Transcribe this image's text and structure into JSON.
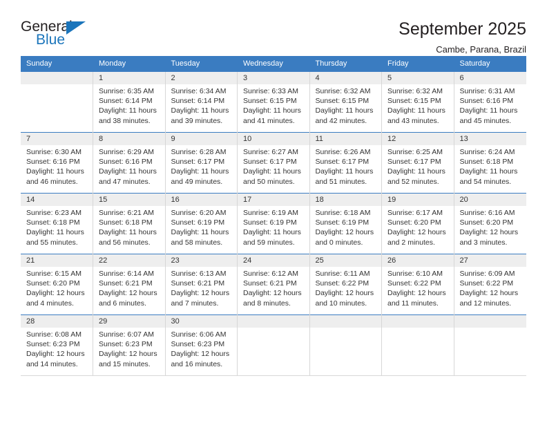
{
  "brand": {
    "name_top": "General",
    "name_bottom": "Blue",
    "accent_color": "#1b75bb"
  },
  "header": {
    "title": "September 2025",
    "subtitle": "Cambe, Parana, Brazil"
  },
  "theme": {
    "header_row_bg": "#3a7cc1",
    "daynum_bg": "#eeeeee",
    "text_color": "#333333",
    "cell_border": "#d7d7d7"
  },
  "weekdays": [
    "Sunday",
    "Monday",
    "Tuesday",
    "Wednesday",
    "Thursday",
    "Friday",
    "Saturday"
  ],
  "labels": {
    "sunrise": "Sunrise:",
    "sunset": "Sunset:",
    "daylight": "Daylight:"
  },
  "weeks": [
    [
      {
        "day": ""
      },
      {
        "day": "1",
        "sunrise": "Sunrise: 6:35 AM",
        "sunset": "Sunset: 6:14 PM",
        "daylight_1": "Daylight: 11 hours",
        "daylight_2": "and 38 minutes."
      },
      {
        "day": "2",
        "sunrise": "Sunrise: 6:34 AM",
        "sunset": "Sunset: 6:14 PM",
        "daylight_1": "Daylight: 11 hours",
        "daylight_2": "and 39 minutes."
      },
      {
        "day": "3",
        "sunrise": "Sunrise: 6:33 AM",
        "sunset": "Sunset: 6:15 PM",
        "daylight_1": "Daylight: 11 hours",
        "daylight_2": "and 41 minutes."
      },
      {
        "day": "4",
        "sunrise": "Sunrise: 6:32 AM",
        "sunset": "Sunset: 6:15 PM",
        "daylight_1": "Daylight: 11 hours",
        "daylight_2": "and 42 minutes."
      },
      {
        "day": "5",
        "sunrise": "Sunrise: 6:32 AM",
        "sunset": "Sunset: 6:15 PM",
        "daylight_1": "Daylight: 11 hours",
        "daylight_2": "and 43 minutes."
      },
      {
        "day": "6",
        "sunrise": "Sunrise: 6:31 AM",
        "sunset": "Sunset: 6:16 PM",
        "daylight_1": "Daylight: 11 hours",
        "daylight_2": "and 45 minutes."
      }
    ],
    [
      {
        "day": "7",
        "sunrise": "Sunrise: 6:30 AM",
        "sunset": "Sunset: 6:16 PM",
        "daylight_1": "Daylight: 11 hours",
        "daylight_2": "and 46 minutes."
      },
      {
        "day": "8",
        "sunrise": "Sunrise: 6:29 AM",
        "sunset": "Sunset: 6:16 PM",
        "daylight_1": "Daylight: 11 hours",
        "daylight_2": "and 47 minutes."
      },
      {
        "day": "9",
        "sunrise": "Sunrise: 6:28 AM",
        "sunset": "Sunset: 6:17 PM",
        "daylight_1": "Daylight: 11 hours",
        "daylight_2": "and 49 minutes."
      },
      {
        "day": "10",
        "sunrise": "Sunrise: 6:27 AM",
        "sunset": "Sunset: 6:17 PM",
        "daylight_1": "Daylight: 11 hours",
        "daylight_2": "and 50 minutes."
      },
      {
        "day": "11",
        "sunrise": "Sunrise: 6:26 AM",
        "sunset": "Sunset: 6:17 PM",
        "daylight_1": "Daylight: 11 hours",
        "daylight_2": "and 51 minutes."
      },
      {
        "day": "12",
        "sunrise": "Sunrise: 6:25 AM",
        "sunset": "Sunset: 6:17 PM",
        "daylight_1": "Daylight: 11 hours",
        "daylight_2": "and 52 minutes."
      },
      {
        "day": "13",
        "sunrise": "Sunrise: 6:24 AM",
        "sunset": "Sunset: 6:18 PM",
        "daylight_1": "Daylight: 11 hours",
        "daylight_2": "and 54 minutes."
      }
    ],
    [
      {
        "day": "14",
        "sunrise": "Sunrise: 6:23 AM",
        "sunset": "Sunset: 6:18 PM",
        "daylight_1": "Daylight: 11 hours",
        "daylight_2": "and 55 minutes."
      },
      {
        "day": "15",
        "sunrise": "Sunrise: 6:21 AM",
        "sunset": "Sunset: 6:18 PM",
        "daylight_1": "Daylight: 11 hours",
        "daylight_2": "and 56 minutes."
      },
      {
        "day": "16",
        "sunrise": "Sunrise: 6:20 AM",
        "sunset": "Sunset: 6:19 PM",
        "daylight_1": "Daylight: 11 hours",
        "daylight_2": "and 58 minutes."
      },
      {
        "day": "17",
        "sunrise": "Sunrise: 6:19 AM",
        "sunset": "Sunset: 6:19 PM",
        "daylight_1": "Daylight: 11 hours",
        "daylight_2": "and 59 minutes."
      },
      {
        "day": "18",
        "sunrise": "Sunrise: 6:18 AM",
        "sunset": "Sunset: 6:19 PM",
        "daylight_1": "Daylight: 12 hours",
        "daylight_2": "and 0 minutes."
      },
      {
        "day": "19",
        "sunrise": "Sunrise: 6:17 AM",
        "sunset": "Sunset: 6:20 PM",
        "daylight_1": "Daylight: 12 hours",
        "daylight_2": "and 2 minutes."
      },
      {
        "day": "20",
        "sunrise": "Sunrise: 6:16 AM",
        "sunset": "Sunset: 6:20 PM",
        "daylight_1": "Daylight: 12 hours",
        "daylight_2": "and 3 minutes."
      }
    ],
    [
      {
        "day": "21",
        "sunrise": "Sunrise: 6:15 AM",
        "sunset": "Sunset: 6:20 PM",
        "daylight_1": "Daylight: 12 hours",
        "daylight_2": "and 4 minutes."
      },
      {
        "day": "22",
        "sunrise": "Sunrise: 6:14 AM",
        "sunset": "Sunset: 6:21 PM",
        "daylight_1": "Daylight: 12 hours",
        "daylight_2": "and 6 minutes."
      },
      {
        "day": "23",
        "sunrise": "Sunrise: 6:13 AM",
        "sunset": "Sunset: 6:21 PM",
        "daylight_1": "Daylight: 12 hours",
        "daylight_2": "and 7 minutes."
      },
      {
        "day": "24",
        "sunrise": "Sunrise: 6:12 AM",
        "sunset": "Sunset: 6:21 PM",
        "daylight_1": "Daylight: 12 hours",
        "daylight_2": "and 8 minutes."
      },
      {
        "day": "25",
        "sunrise": "Sunrise: 6:11 AM",
        "sunset": "Sunset: 6:22 PM",
        "daylight_1": "Daylight: 12 hours",
        "daylight_2": "and 10 minutes."
      },
      {
        "day": "26",
        "sunrise": "Sunrise: 6:10 AM",
        "sunset": "Sunset: 6:22 PM",
        "daylight_1": "Daylight: 12 hours",
        "daylight_2": "and 11 minutes."
      },
      {
        "day": "27",
        "sunrise": "Sunrise: 6:09 AM",
        "sunset": "Sunset: 6:22 PM",
        "daylight_1": "Daylight: 12 hours",
        "daylight_2": "and 12 minutes."
      }
    ],
    [
      {
        "day": "28",
        "sunrise": "Sunrise: 6:08 AM",
        "sunset": "Sunset: 6:23 PM",
        "daylight_1": "Daylight: 12 hours",
        "daylight_2": "and 14 minutes."
      },
      {
        "day": "29",
        "sunrise": "Sunrise: 6:07 AM",
        "sunset": "Sunset: 6:23 PM",
        "daylight_1": "Daylight: 12 hours",
        "daylight_2": "and 15 minutes."
      },
      {
        "day": "30",
        "sunrise": "Sunrise: 6:06 AM",
        "sunset": "Sunset: 6:23 PM",
        "daylight_1": "Daylight: 12 hours",
        "daylight_2": "and 16 minutes."
      },
      {
        "day": ""
      },
      {
        "day": ""
      },
      {
        "day": ""
      },
      {
        "day": ""
      }
    ]
  ]
}
